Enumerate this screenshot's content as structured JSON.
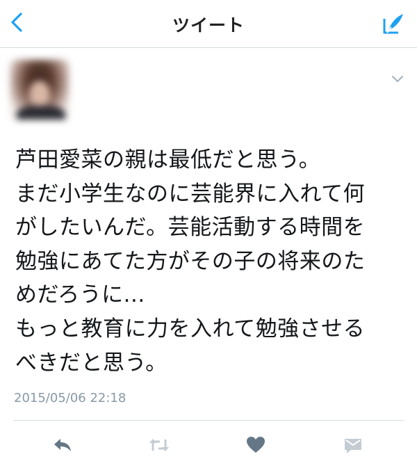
{
  "header": {
    "title": "ツイート",
    "back_icon": "chevron-left-icon",
    "compose_icon": "compose-quill-icon",
    "accent_color": "#1da1f2"
  },
  "tweet": {
    "author": {
      "display_name": "            ",
      "handle": "        "
    },
    "text": "芦田愛菜の親は最低だと思う。\nまだ小学生なのに芸能界に入れて何\nがしたいんだ。芸能活動する時間を\n勉強にあてた方がその子の将来のた\nめだろうに...\nもっと教育に力を入れて勉強させる\nべきだと思う。",
    "timestamp": "2015/05/06 22:18"
  },
  "actions": [
    {
      "icon": "reply-icon"
    },
    {
      "icon": "retweet-icon"
    },
    {
      "icon": "heart-icon"
    },
    {
      "icon": "direct-message-icon"
    }
  ]
}
